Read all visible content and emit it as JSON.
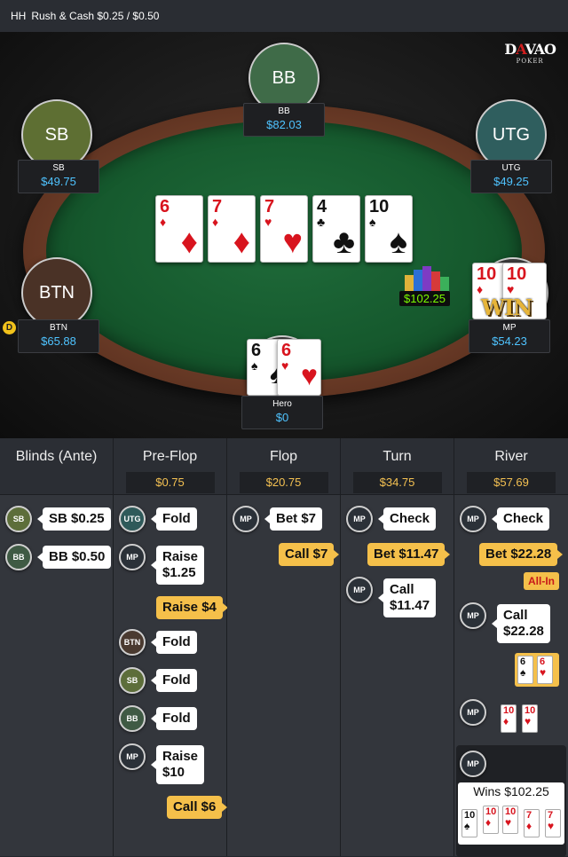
{
  "title": {
    "hh": "HH",
    "game": "Rush & Cash $0.25 / $0.50"
  },
  "logo": {
    "line1a": "D",
    "line1b": "A",
    "line1c": "VAO",
    "line2": "POKER"
  },
  "seats": {
    "bb": {
      "avatar": "BB",
      "name": "BB",
      "stack": "$82.03",
      "color": "#3f6b48"
    },
    "sb": {
      "avatar": "SB",
      "name": "SB",
      "stack": "$49.75",
      "color": "#5e6f33"
    },
    "utg": {
      "avatar": "UTG",
      "name": "UTG",
      "stack": "$49.25",
      "color": "#2f5e5e"
    },
    "btn": {
      "avatar": "BTN",
      "name": "BTN",
      "stack": "$65.88",
      "color": "#4a3226"
    },
    "mp": {
      "name": "MP",
      "stack": "$54.23"
    },
    "hero": {
      "name": "Hero",
      "stack": "$0"
    }
  },
  "dealer_button": "D",
  "pot_badge": "$102.25",
  "win_text": "WIN",
  "board": [
    {
      "rank": "6",
      "suit": "♦",
      "color": "red"
    },
    {
      "rank": "7",
      "suit": "♦",
      "color": "red"
    },
    {
      "rank": "7",
      "suit": "♥",
      "color": "red"
    },
    {
      "rank": "4",
      "suit": "♣",
      "color": "black"
    },
    {
      "rank": "10",
      "suit": "♠",
      "color": "black"
    }
  ],
  "hero_cards": [
    {
      "rank": "6",
      "suit": "♠",
      "color": "black"
    },
    {
      "rank": "6",
      "suit": "♥",
      "color": "red"
    }
  ],
  "mp_cards": [
    {
      "rank": "10",
      "suit": "♦",
      "color": "red"
    },
    {
      "rank": "10",
      "suit": "♥",
      "color": "red"
    }
  ],
  "log": {
    "columns": [
      {
        "title": "Blinds (Ante)",
        "pot": ""
      },
      {
        "title": "Pre-Flop",
        "pot": "$0.75"
      },
      {
        "title": "Flop",
        "pot": "$20.75"
      },
      {
        "title": "Turn",
        "pot": "$34.75"
      },
      {
        "title": "River",
        "pot": "$57.69"
      }
    ],
    "blinds": [
      {
        "pos": "SB",
        "action": "SB $0.25"
      },
      {
        "pos": "BB",
        "action": "BB $0.50"
      }
    ],
    "preflop": {
      "utg": {
        "pos": "UTG",
        "action": "Fold"
      },
      "mp": {
        "pos": "MP",
        "action1": "Raise",
        "action2": "$1.25"
      },
      "hero_raise": "Raise $4",
      "btn": {
        "pos": "BTN",
        "action": "Fold"
      },
      "sb": {
        "pos": "SB",
        "action": "Fold"
      },
      "bb": {
        "pos": "BB",
        "action": "Fold"
      },
      "mp2": {
        "pos": "MP",
        "action1": "Raise",
        "action2": "$10"
      },
      "hero_call": "Call $6"
    },
    "flop": {
      "mp": {
        "pos": "MP",
        "action": "Bet $7"
      },
      "hero_call": "Call $7"
    },
    "turn": {
      "mp": {
        "pos": "MP",
        "action": "Check"
      },
      "hero_bet": "Bet $11.47",
      "mp2": {
        "pos": "MP",
        "action1": "Call",
        "action2": "$11.47"
      }
    },
    "river": {
      "mp": {
        "pos": "MP",
        "action": "Check"
      },
      "hero_bet": "Bet $22.28",
      "allin": "All-In",
      "mp2": {
        "pos": "MP",
        "action1": "Call",
        "action2": "$22.28"
      },
      "hero_show": [
        {
          "rank": "6",
          "suit": "♠",
          "color": "black"
        },
        {
          "rank": "6",
          "suit": "♥",
          "color": "red"
        }
      ],
      "mp3": {
        "pos": "MP"
      },
      "mp_show": [
        {
          "rank": "10",
          "suit": "♦",
          "color": "red"
        },
        {
          "rank": "10",
          "suit": "♥",
          "color": "red"
        }
      ],
      "mp4": {
        "pos": "MP"
      },
      "wins": "Wins $102.25",
      "win_hand": [
        {
          "rank": "10",
          "suit": "♠",
          "color": "black"
        },
        {
          "rank": "10",
          "suit": "♦",
          "color": "red"
        },
        {
          "rank": "10",
          "suit": "♥",
          "color": "red"
        },
        {
          "rank": "7",
          "suit": "♦",
          "color": "red"
        },
        {
          "rank": "7",
          "suit": "♥",
          "color": "red"
        }
      ]
    }
  }
}
